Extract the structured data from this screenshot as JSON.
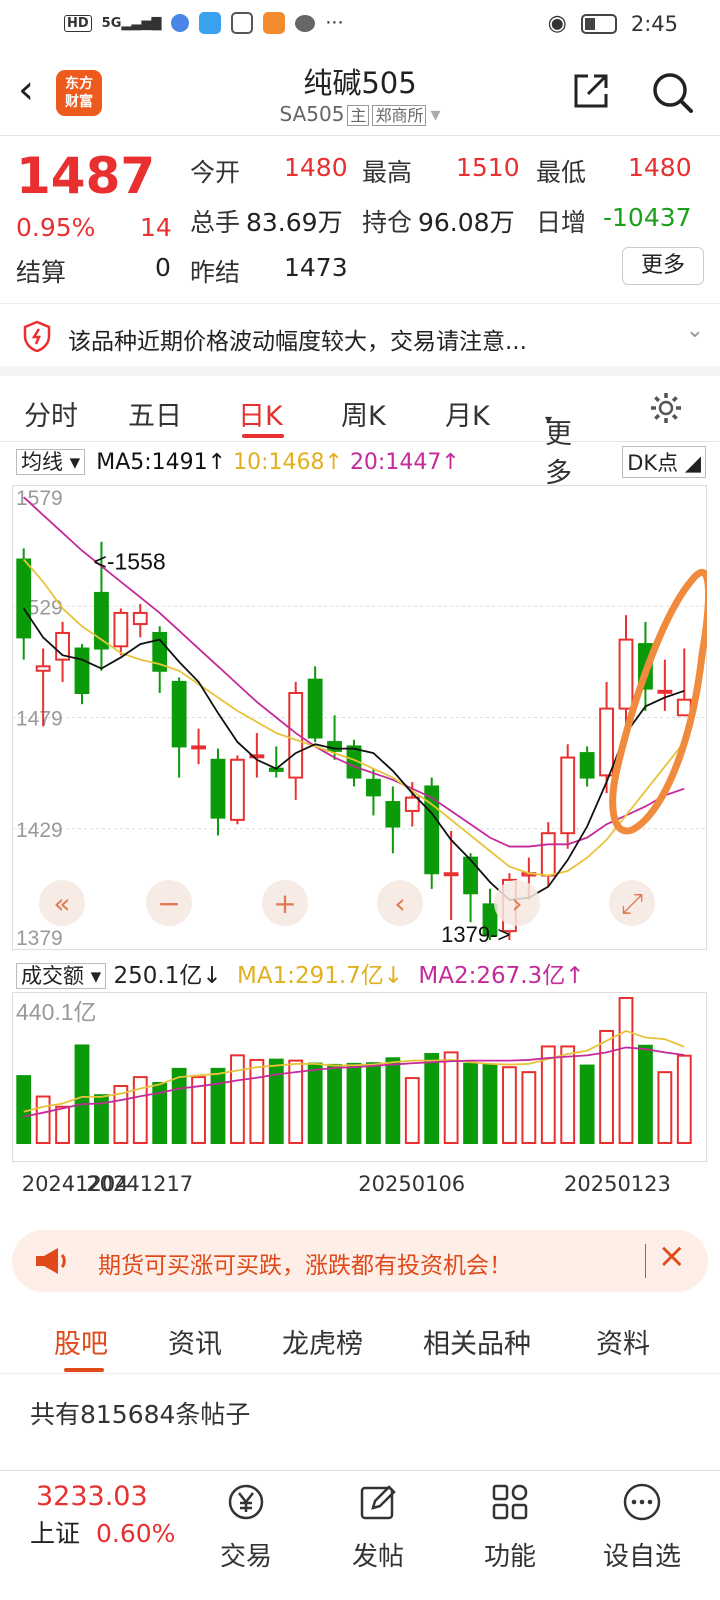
{
  "status": {
    "left_icons": [
      "hd-icon",
      "5g-signal-icon",
      "app-icon",
      "cloud-icon",
      "hand-icon",
      "play-icon",
      "chat-icon",
      "more-dots-icon"
    ],
    "time": "2:45"
  },
  "header": {
    "title": "纯碱505",
    "code": "SA505",
    "main_tag": "主",
    "exchange": "郑商所",
    "logo_text_1": "东方",
    "logo_text_2": "财富"
  },
  "quote": {
    "price": "1487",
    "change_pct": "0.95%",
    "change": "14",
    "open_label": "今开",
    "open": "1480",
    "high_label": "最高",
    "high": "1510",
    "low_label": "最低",
    "low": "1480",
    "volume_label": "总手",
    "volume": "83.69万",
    "oi_label": "持仓",
    "oi": "96.08万",
    "daily_inc_label": "日增",
    "daily_inc": "-10437",
    "settle_label": "结算",
    "settle": "0",
    "prev_settle_label": "昨结",
    "prev_settle": "1473",
    "more": "更多"
  },
  "warning": {
    "text": "该品种近期价格波动幅度较大，交易请注意..."
  },
  "tabs": [
    "分时",
    "五日",
    "日K",
    "周K",
    "月K",
    "更多"
  ],
  "active_tab": 2,
  "ma": {
    "selector": "均线",
    "ma5": "MA5:1491",
    "ma10": "10:1468",
    "ma20": "20:1447",
    "dk": "DK点"
  },
  "vol": {
    "selector": "成交额",
    "value": "250.1亿",
    "ma1": "MA1:291.7亿",
    "ma2": "MA2:267.3亿",
    "max_label": "440.1亿"
  },
  "colors": {
    "up": "#e93030",
    "down": "#0a9a0a",
    "ma5": "#111111",
    "ma10": "#e8c33a",
    "ma20": "#c42a9a",
    "annotation": "#f08a3c"
  },
  "chart_data": {
    "type": "candlestick",
    "y_tick_labels": [
      "1579",
      "1529",
      "1479",
      "1429",
      "1379"
    ],
    "ylim": [
      1379,
      1579
    ],
    "annotations": [
      "<-1558",
      "1379->"
    ],
    "x_labels": [
      "20241204",
      "20241217",
      "20250106",
      "20250123"
    ],
    "candles": [
      {
        "o": 1550,
        "c": 1515,
        "h": 1555,
        "l": 1505
      },
      {
        "o": 1500,
        "c": 1502,
        "h": 1510,
        "l": 1475
      },
      {
        "o": 1505,
        "c": 1517,
        "h": 1522,
        "l": 1495
      },
      {
        "o": 1510,
        "c": 1490,
        "h": 1512,
        "l": 1485
      },
      {
        "o": 1535,
        "c": 1510,
        "h": 1558,
        "l": 1500
      },
      {
        "o": 1511,
        "c": 1526,
        "h": 1528,
        "l": 1507
      },
      {
        "o": 1521,
        "c": 1526,
        "h": 1530,
        "l": 1515
      },
      {
        "o": 1517,
        "c": 1500,
        "h": 1520,
        "l": 1490
      },
      {
        "o": 1495,
        "c": 1466,
        "h": 1497,
        "l": 1452
      },
      {
        "o": 1466,
        "c": 1466,
        "h": 1474,
        "l": 1458
      },
      {
        "o": 1460,
        "c": 1434,
        "h": 1465,
        "l": 1426
      },
      {
        "o": 1433,
        "c": 1460,
        "h": 1462,
        "l": 1431
      },
      {
        "o": 1462,
        "c": 1462,
        "h": 1472,
        "l": 1452
      },
      {
        "o": 1456,
        "c": 1455,
        "h": 1466,
        "l": 1452
      },
      {
        "o": 1452,
        "c": 1490,
        "h": 1495,
        "l": 1442
      },
      {
        "o": 1496,
        "c": 1470,
        "h": 1502,
        "l": 1468
      },
      {
        "o": 1468,
        "c": 1464,
        "h": 1480,
        "l": 1460
      },
      {
        "o": 1466,
        "c": 1452,
        "h": 1469,
        "l": 1448
      },
      {
        "o": 1451,
        "c": 1444,
        "h": 1456,
        "l": 1435
      },
      {
        "o": 1441,
        "c": 1430,
        "h": 1448,
        "l": 1418
      },
      {
        "o": 1437,
        "c": 1443,
        "h": 1450,
        "l": 1430
      },
      {
        "o": 1448,
        "c": 1409,
        "h": 1452,
        "l": 1402
      },
      {
        "o": 1409,
        "c": 1409,
        "h": 1428,
        "l": 1388
      },
      {
        "o": 1416,
        "c": 1400,
        "h": 1418,
        "l": 1387
      },
      {
        "o": 1395,
        "c": 1381,
        "h": 1402,
        "l": 1379
      },
      {
        "o": 1383,
        "c": 1406,
        "h": 1409,
        "l": 1379
      },
      {
        "o": 1408,
        "c": 1409,
        "h": 1416,
        "l": 1397
      },
      {
        "o": 1408,
        "c": 1427,
        "h": 1432,
        "l": 1403
      },
      {
        "o": 1427,
        "c": 1461,
        "h": 1467,
        "l": 1420
      },
      {
        "o": 1463,
        "c": 1452,
        "h": 1466,
        "l": 1448
      },
      {
        "o": 1453,
        "c": 1483,
        "h": 1495,
        "l": 1445
      },
      {
        "o": 1483,
        "c": 1514,
        "h": 1525,
        "l": 1468
      },
      {
        "o": 1512,
        "c": 1492,
        "h": 1522,
        "l": 1482
      },
      {
        "o": 1491,
        "c": 1491,
        "h": 1505,
        "l": 1482
      },
      {
        "o": 1480,
        "c": 1487,
        "h": 1510,
        "l": 1480
      }
    ],
    "ma5": [
      1528,
      1515,
      1507,
      1505,
      1501,
      1506,
      1512,
      1514,
      1504,
      1495,
      1481,
      1468,
      1460,
      1456,
      1463,
      1467,
      1465,
      1465,
      1463,
      1455,
      1445,
      1436,
      1424,
      1415,
      1405,
      1397,
      1398,
      1403,
      1415,
      1430,
      1450,
      1472,
      1484,
      1488,
      1491
    ],
    "ma10": [
      1550,
      1540,
      1528,
      1520,
      1514,
      1508,
      1505,
      1503,
      1500,
      1494,
      1488,
      1482,
      1477,
      1472,
      1469,
      1466,
      1463,
      1460,
      1456,
      1452,
      1446,
      1440,
      1433,
      1426,
      1419,
      1412,
      1409,
      1408,
      1410,
      1416,
      1424,
      1435,
      1446,
      1457,
      1468
    ],
    "ma20": [
      1578,
      1570,
      1562,
      1554,
      1547,
      1540,
      1533,
      1526,
      1518,
      1510,
      1502,
      1494,
      1486,
      1479,
      1472,
      1466,
      1461,
      1457,
      1454,
      1451,
      1447,
      1443,
      1437,
      1431,
      1425,
      1421,
      1421,
      1422,
      1422,
      1425,
      1431,
      1435,
      1439,
      1444,
      1447
    ],
    "volume_yi": [
      203,
      141,
      110,
      296,
      145,
      173,
      200,
      182,
      225,
      200,
      225,
      266,
      252,
      253,
      250,
      241,
      237,
      240,
      242,
      257,
      197,
      270,
      275,
      240,
      238,
      230,
      215,
      293,
      293,
      235,
      340,
      440,
      295,
      215,
      265
    ],
    "vol_ma1": [
      95,
      110,
      120,
      140,
      140,
      150,
      165,
      178,
      200,
      205,
      210,
      220,
      230,
      235,
      240,
      240,
      235,
      236,
      238,
      245,
      250,
      250,
      252,
      245,
      240,
      238,
      240,
      255,
      270,
      280,
      310,
      340,
      320,
      315,
      292
    ],
    "vol_ma2": [
      80,
      92,
      105,
      118,
      120,
      130,
      142,
      152,
      165,
      172,
      180,
      190,
      198,
      208,
      215,
      222,
      228,
      230,
      234,
      238,
      242,
      245,
      248,
      250,
      250,
      250,
      252,
      258,
      262,
      266,
      275,
      290,
      285,
      275,
      267
    ]
  },
  "promo": {
    "text": "期货可买涨可买跌，涨跌都有投资机会！"
  },
  "bottom_tabs": [
    "股吧",
    "资讯",
    "龙虎榜",
    "相关品种",
    "资料"
  ],
  "posts": {
    "count_text": "共有815684条帖子"
  },
  "footer": {
    "index_value": "3233.03",
    "index_name": "上证",
    "index_pct": "0.60%",
    "items": [
      "交易",
      "发帖",
      "功能",
      "设自选"
    ]
  }
}
